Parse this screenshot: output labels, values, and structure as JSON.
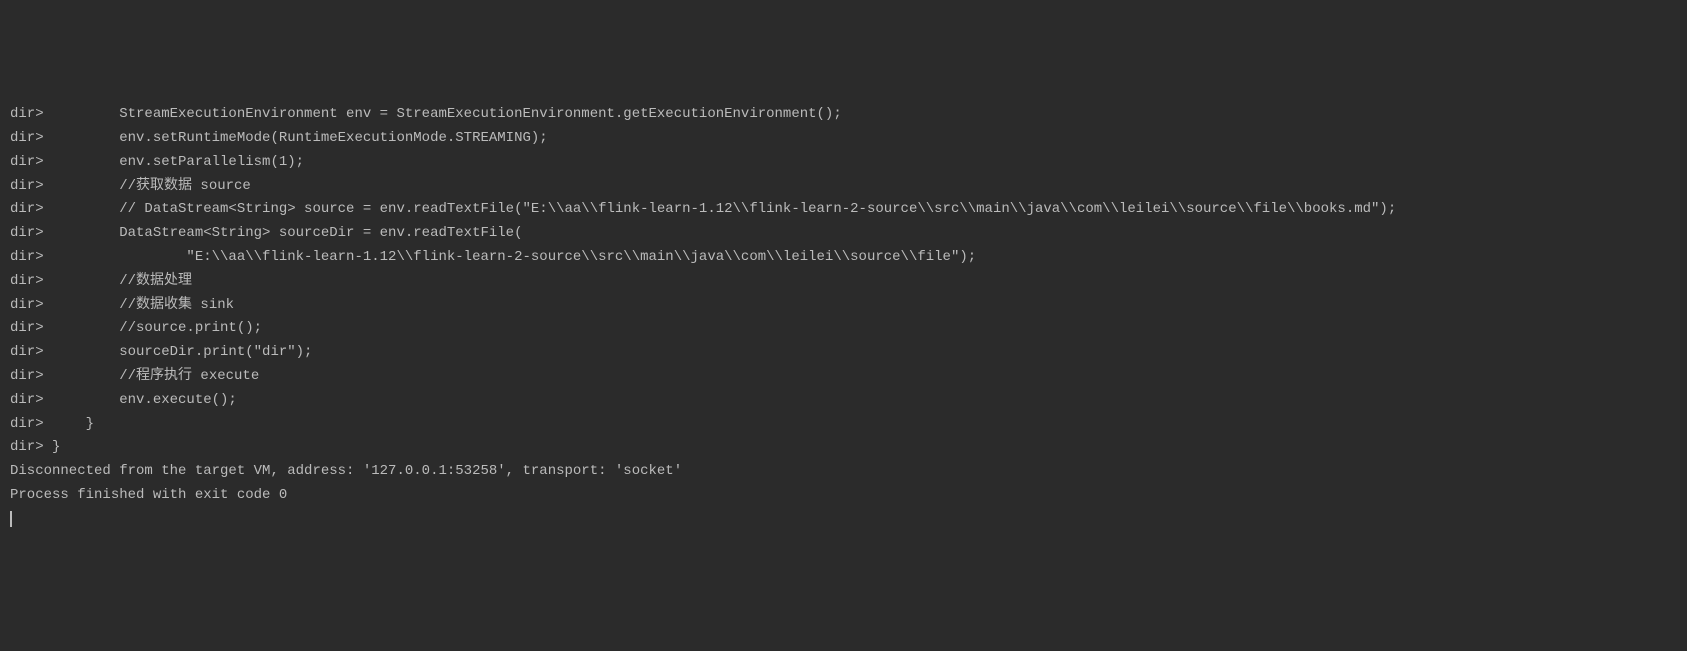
{
  "console": {
    "lines": [
      "dir>         StreamExecutionEnvironment env = StreamExecutionEnvironment.getExecutionEnvironment();",
      "dir>         env.setRuntimeMode(RuntimeExecutionMode.STREAMING);",
      "dir>         env.setParallelism(1);",
      "dir>         //获取数据 source",
      "dir>         // DataStream<String> source = env.readTextFile(\"E:\\\\aa\\\\flink-learn-1.12\\\\flink-learn-2-source\\\\src\\\\main\\\\java\\\\com\\\\leilei\\\\source\\\\file\\\\books.md\");",
      "dir>         DataStream<String> sourceDir = env.readTextFile(",
      "dir>                 \"E:\\\\aa\\\\flink-learn-1.12\\\\flink-learn-2-source\\\\src\\\\main\\\\java\\\\com\\\\leilei\\\\source\\\\file\");",
      "dir>         //数据处理",
      "dir>         //数据收集 sink",
      "dir>         //source.print();",
      "dir>         sourceDir.print(\"dir\");",
      "dir>         //程序执行 execute",
      "dir>         env.execute();",
      "dir>     }",
      "dir> }",
      "Disconnected from the target VM, address: '127.0.0.1:53258', transport: 'socket'",
      "",
      "Process finished with exit code 0"
    ]
  }
}
